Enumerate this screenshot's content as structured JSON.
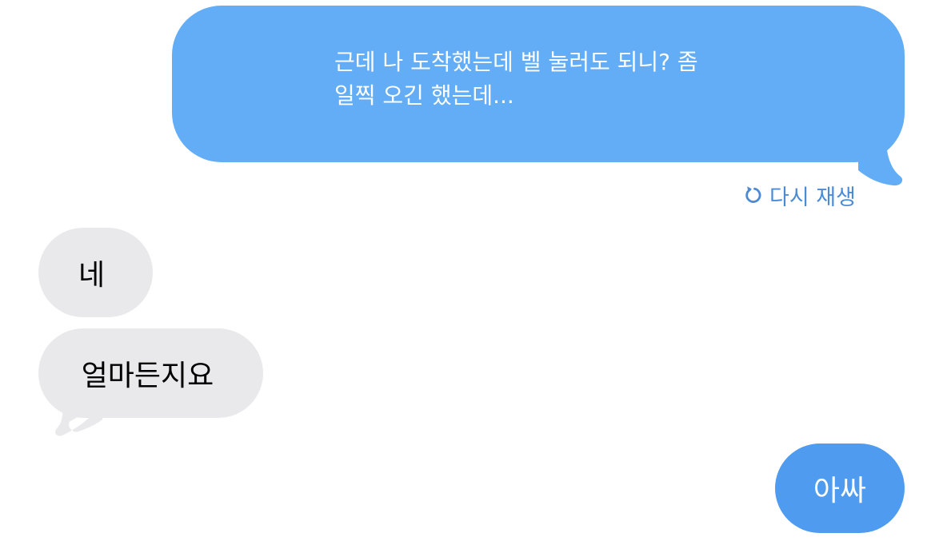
{
  "messages": [
    {
      "direction": "outgoing",
      "text": "근데 나 도착했는데 벨 눌러도 되니? 좀\n일찍 오긴 했는데...",
      "effect": "animated",
      "bubble_color": "#62adf6"
    },
    {
      "direction": "incoming",
      "text": "네",
      "bubble_color": "#e9e9eb"
    },
    {
      "direction": "incoming",
      "text": "얼마든지요",
      "bubble_color": "#e9e9eb"
    },
    {
      "direction": "outgoing",
      "text": "아싸",
      "bubble_color": "#4f9bf0"
    }
  ],
  "replay": {
    "icon": "replay-icon",
    "label": "다시 재생",
    "color": "#4b8bd6"
  },
  "colors": {
    "background": "#ffffff",
    "outgoing_text": "#ffffff",
    "incoming_text": "#000000"
  }
}
